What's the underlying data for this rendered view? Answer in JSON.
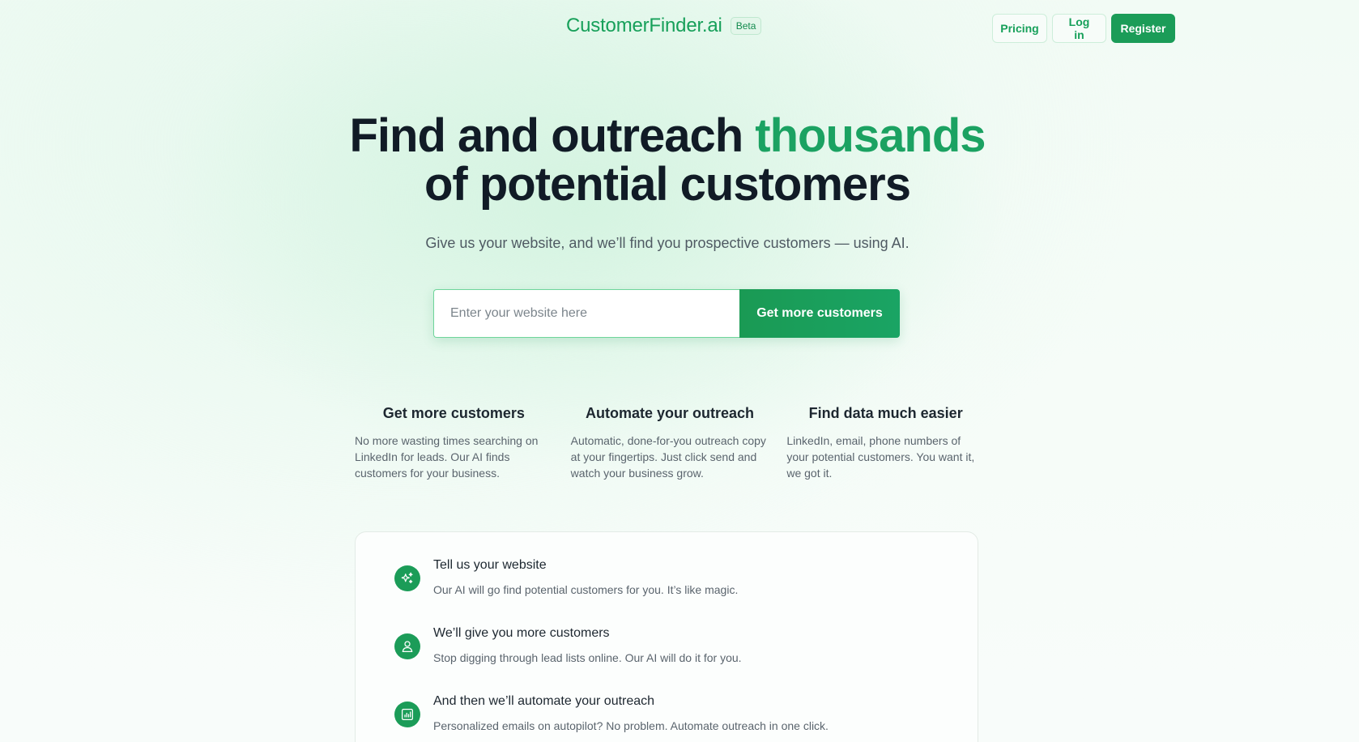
{
  "header": {
    "brand": "CustomerFinder.ai",
    "badge": "Beta",
    "nav": {
      "pricing": "Pricing",
      "login": "Log in",
      "register": "Register"
    }
  },
  "hero": {
    "title_part1": "Find and outreach ",
    "title_accent": "thousands",
    "title_part2": "of potential customers",
    "subtitle": "Give us your website, and we’ll find you prospective customers — using AI.",
    "input_placeholder": "Enter your website here",
    "input_value": "",
    "cta": "Get more customers"
  },
  "features": [
    {
      "title": "Get more customers",
      "desc": "No more wasting times searching on LinkedIn for leads. Our AI finds customers for your business."
    },
    {
      "title": "Automate your outreach",
      "desc": "Automatic, done-for-you outreach copy at your fingertips. Just click send and watch your business grow."
    },
    {
      "title": "Find data much easier",
      "desc": "LinkedIn, email, phone numbers of your potential customers. You want it, we got it."
    }
  ],
  "steps": [
    {
      "icon": "sparkles-icon",
      "title": "Tell us your website",
      "desc": "Our AI will go find potential customers for you. It’s like magic."
    },
    {
      "icon": "user-icon",
      "title": "We’ll give you more customers",
      "desc": "Stop digging through lead lists online. Our AI will do it for you."
    },
    {
      "icon": "chart-icon",
      "title": "And then we’ll automate your outreach",
      "desc": "Personalized emails on autopilot? No problem. Automate outreach in one click."
    }
  ],
  "colors": {
    "brand": "#17a05a",
    "accent": "#1ba262",
    "button": "#1b9c58"
  }
}
